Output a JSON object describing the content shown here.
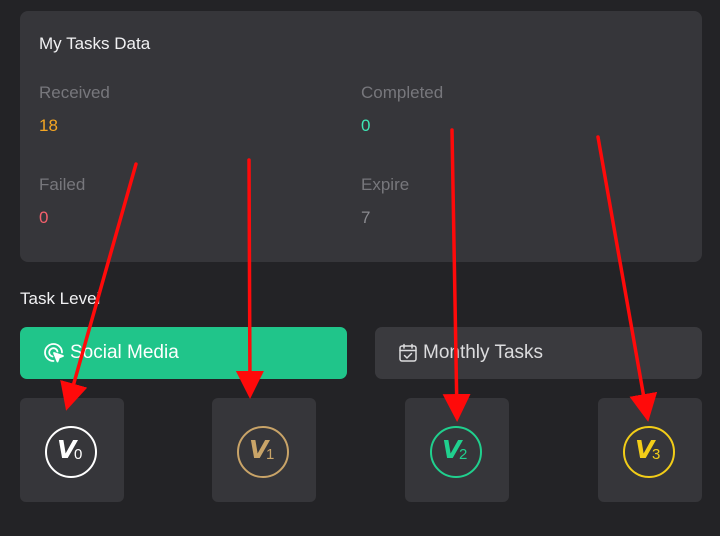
{
  "tasks_card": {
    "title": "My Tasks Data",
    "received": {
      "label": "Received",
      "value": "18",
      "color": "#f5a623"
    },
    "completed": {
      "label": "Completed",
      "value": "0",
      "color": "#3ee6b4"
    },
    "failed": {
      "label": "Failed",
      "value": "0",
      "color": "#f4606c"
    },
    "expire": {
      "label": "Expire",
      "value": "7",
      "color": "#8a8a8f"
    }
  },
  "task_level": {
    "title": "Task Level",
    "tabs": [
      {
        "label": "Social Media",
        "icon": "cursor-click-icon",
        "active": true
      },
      {
        "label": "Monthly Tasks",
        "icon": "calendar-check-icon",
        "active": false
      }
    ],
    "levels": [
      {
        "v": "V",
        "num": "0",
        "color": "#ffffff"
      },
      {
        "v": "V",
        "num": "1",
        "color": "#c9a468"
      },
      {
        "v": "V",
        "num": "2",
        "color": "#20d08e"
      },
      {
        "v": "V",
        "num": "3",
        "color": "#f2cd18"
      }
    ]
  },
  "colors": {
    "accent": "#20c58a",
    "arrow": "#ff0a0a"
  }
}
